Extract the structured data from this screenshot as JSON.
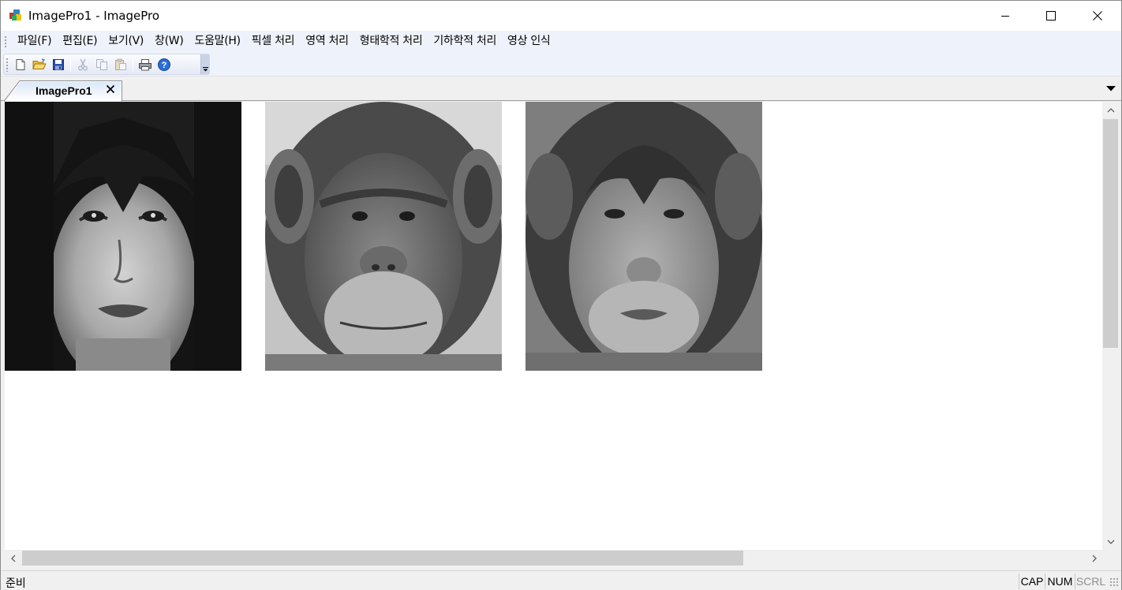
{
  "window": {
    "title": "ImagePro1 - ImagePro",
    "icon": "imagepro-app-icon"
  },
  "menu": {
    "items": [
      "파일(F)",
      "편집(E)",
      "보기(V)",
      "창(W)",
      "도움말(H)",
      "픽셀 처리",
      "영역 처리",
      "형태학적 처리",
      "기하학적 처리",
      "영상 인식"
    ]
  },
  "toolbar": {
    "buttons": [
      {
        "icon": "new-file-icon",
        "enabled": true
      },
      {
        "icon": "open-folder-icon",
        "enabled": true
      },
      {
        "icon": "save-disk-icon",
        "enabled": true
      },
      {
        "icon": "cut-scissors-icon",
        "enabled": false
      },
      {
        "icon": "copy-icon",
        "enabled": false
      },
      {
        "icon": "paste-icon",
        "enabled": false
      },
      {
        "icon": "print-icon",
        "enabled": true
      },
      {
        "icon": "help-icon",
        "enabled": true
      }
    ]
  },
  "tabs": [
    {
      "label": "ImagePro1",
      "active": true
    }
  ],
  "document": {
    "images": [
      {
        "name": "woman-face-image",
        "description": "grayscale"
      },
      {
        "name": "chimpanzee-face-image",
        "description": "grayscale"
      },
      {
        "name": "morphed-face-image",
        "description": "grayscale"
      }
    ]
  },
  "statusbar": {
    "text": "준비",
    "indicators": [
      {
        "label": "CAP",
        "active": true
      },
      {
        "label": "NUM",
        "active": true
      },
      {
        "label": "SCRL",
        "active": false
      }
    ]
  },
  "colors": {
    "menubar_bg": "#eef2fb",
    "tab_active_bg": "#dbe8f8",
    "scroll_thumb": "#cdcdcd"
  }
}
